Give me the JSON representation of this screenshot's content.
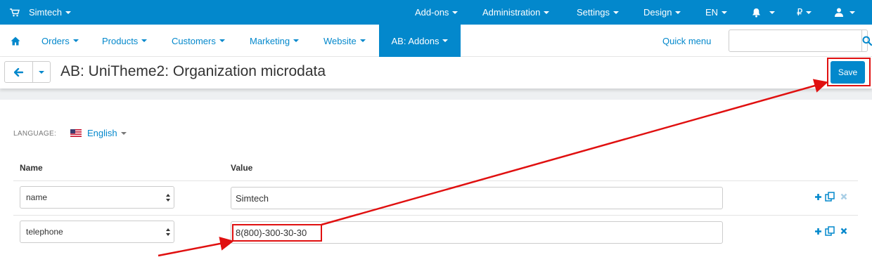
{
  "topbar": {
    "store": "Simtech",
    "menus": [
      "Add-ons",
      "Administration",
      "Settings",
      "Design",
      "EN"
    ],
    "currency": "₽"
  },
  "navbar": {
    "items": [
      "Orders",
      "Products",
      "Customers",
      "Marketing",
      "Website"
    ],
    "active": "AB: Addons",
    "quick_menu": "Quick menu",
    "search_value": ""
  },
  "page": {
    "title": "AB: UniTheme2: Organization microdata",
    "save_label": "Save"
  },
  "content": {
    "language_label": "LANGUAGE:",
    "language_value": "English",
    "columns": [
      "Name",
      "Value"
    ],
    "rows": [
      {
        "name": "name",
        "value": "Simtech"
      },
      {
        "name": "telephone",
        "value": "8(800)-300-30-30"
      }
    ]
  },
  "colors": {
    "primary": "#0388cc",
    "annotation": "#e01010"
  }
}
